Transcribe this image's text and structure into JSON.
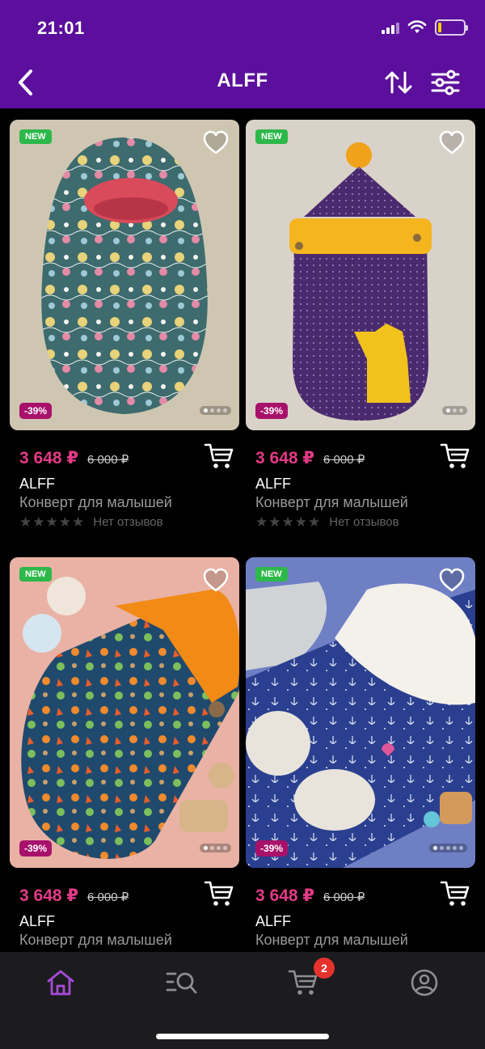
{
  "status_bar": {
    "time": "21:01"
  },
  "header": {
    "title": "ALFF"
  },
  "icons": {
    "back": "chevron-left-icon",
    "sort": "sort-arrows-icon",
    "filter": "sliders-icon",
    "favorite": "heart-outline-icon",
    "cart": "cart-icon"
  },
  "colors": {
    "header_bg": "#5b0f9c",
    "price": "#e23b86",
    "new_badge": "#2db84a",
    "sale_badge": "#a8116a",
    "active_tab": "#a54bd6",
    "cart_badge": "#e5322d"
  },
  "products": [
    {
      "new_label": "NEW",
      "discount": "-39%",
      "price": "3 648 ₽",
      "old_price": "6 000 ₽",
      "brand": "ALFF",
      "title": "Конверт для малышей",
      "reviews": "Нет отзывов",
      "photo_count": 4,
      "active_photo": 1
    },
    {
      "new_label": "NEW",
      "discount": "-39%",
      "price": "3 648 ₽",
      "old_price": "6 000 ₽",
      "brand": "ALFF",
      "title": "Конверт для малышей",
      "reviews": "Нет отзывов",
      "photo_count": 3,
      "active_photo": 1
    },
    {
      "new_label": "NEW",
      "discount": "-39%",
      "price": "3 648 ₽",
      "old_price": "6 000 ₽",
      "brand": "ALFF",
      "title": "Конверт для малышей",
      "photo_count": 4,
      "active_photo": 1
    },
    {
      "new_label": "NEW",
      "discount": "-39%",
      "price": "3 648 ₽",
      "old_price": "6 000 ₽",
      "brand": "ALFF",
      "title": "Конверт для малышей",
      "photo_count": 5,
      "active_photo": 1
    }
  ],
  "tabbar": {
    "items": [
      {
        "name": "home",
        "icon": "home-icon",
        "active": true
      },
      {
        "name": "catalog-search",
        "icon": "catalog-search-icon",
        "active": false
      },
      {
        "name": "cart",
        "icon": "cart-icon",
        "active": false
      },
      {
        "name": "profile",
        "icon": "profile-icon",
        "active": false
      }
    ],
    "cart_count": "2"
  }
}
